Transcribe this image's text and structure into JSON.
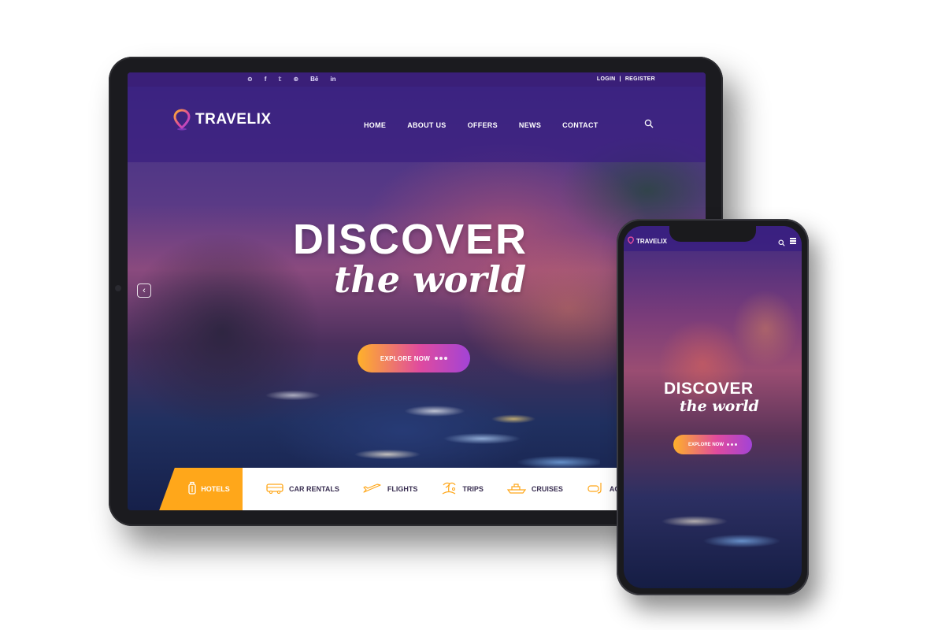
{
  "brand": {
    "name": "TRAVELIX"
  },
  "topbar": {
    "social_icons": [
      "pinterest-icon",
      "facebook-icon",
      "twitter-icon",
      "dribbble-icon",
      "behance-icon",
      "linkedin-icon"
    ],
    "social_glyphs": [
      "⊙",
      "f",
      "𝕥",
      "⊛",
      "Bē",
      "in"
    ],
    "login": "LOGIN",
    "separator": "|",
    "register": "REGISTER"
  },
  "nav": {
    "items": [
      "HOME",
      "ABOUT US",
      "OFFERS",
      "NEWS",
      "CONTACT"
    ]
  },
  "hero": {
    "title": "DISCOVER",
    "subtitle": "the world",
    "button_label": "EXPLORE NOW"
  },
  "categories": {
    "items": [
      "HOTELS",
      "CAR RENTALS",
      "FLIGHTS",
      "TRIPS",
      "CRUISES",
      "ACTIV"
    ]
  },
  "colors": {
    "brand_purple": "#3a1f78",
    "accent_orange": "#ffa71a",
    "gradient_start": "#ffb12a",
    "gradient_end": "#a243d6"
  }
}
